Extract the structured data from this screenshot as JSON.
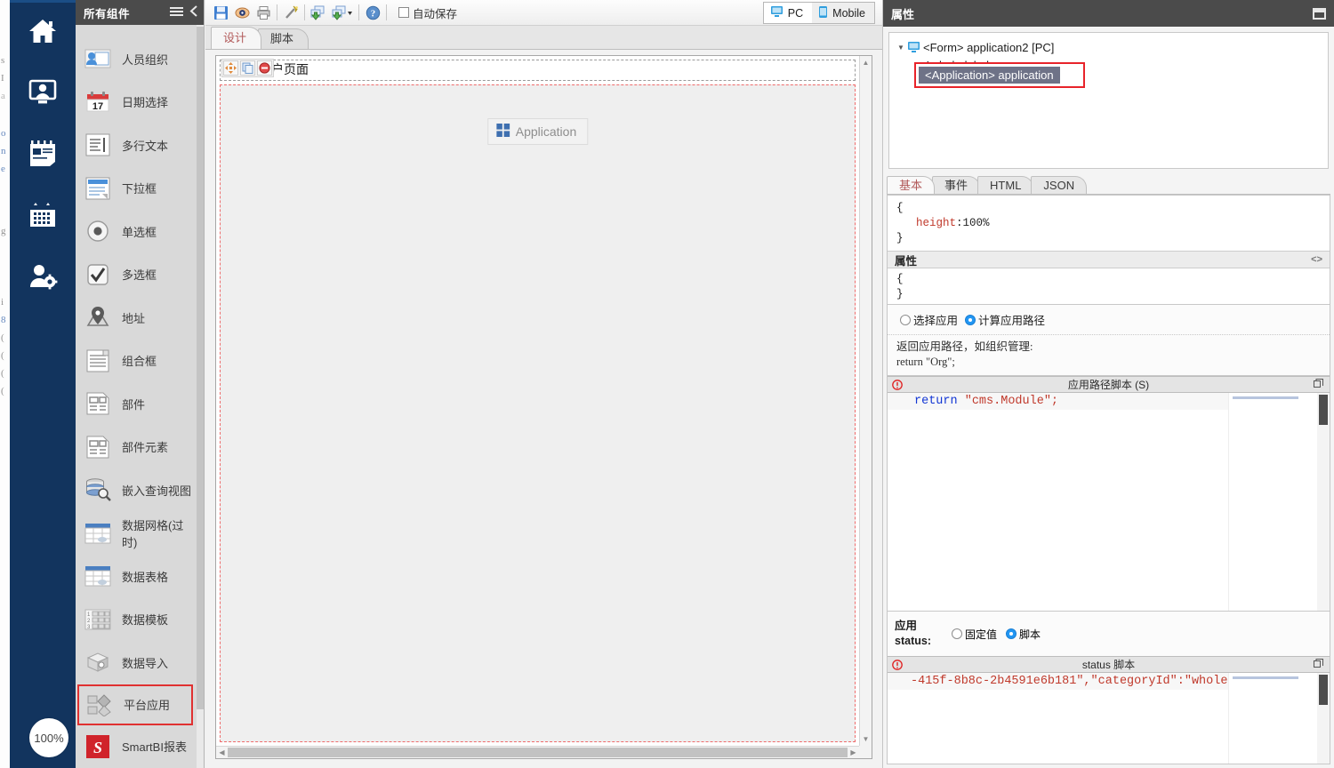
{
  "rail": {
    "items": [
      {
        "name": "home-icon",
        "label": "首页"
      },
      {
        "name": "user-monitor-icon",
        "label": "用户"
      },
      {
        "name": "news-icon",
        "label": "资讯"
      },
      {
        "name": "calendar-icon",
        "label": "日历"
      },
      {
        "name": "user-settings-icon",
        "label": "用户设置"
      }
    ],
    "zoom_badge": "100%"
  },
  "palette": {
    "title": "所有组件",
    "menu_icon": "hamburger-icon",
    "collapse_icon": "chevron-left-icon",
    "items": [
      {
        "label": "人员组织",
        "icon": "person-org-icon"
      },
      {
        "label": "日期选择",
        "icon": "date-picker-icon",
        "day": "17"
      },
      {
        "label": "多行文本",
        "icon": "multiline-text-icon"
      },
      {
        "label": "下拉框",
        "icon": "dropdown-icon"
      },
      {
        "label": "单选框",
        "icon": "radio-icon"
      },
      {
        "label": "多选框",
        "icon": "checkbox-icon"
      },
      {
        "label": "地址",
        "icon": "map-pin-icon"
      },
      {
        "label": "组合框",
        "icon": "combobox-icon"
      },
      {
        "label": "部件",
        "icon": "widget-icon"
      },
      {
        "label": "部件元素",
        "icon": "widget-element-icon"
      },
      {
        "label": "嵌入查询视图",
        "icon": "db-search-icon"
      },
      {
        "label": "数据网格(过时)",
        "icon": "data-grid-icon"
      },
      {
        "label": "数据表格",
        "icon": "data-table-icon"
      },
      {
        "label": "数据模板",
        "icon": "data-template-icon"
      },
      {
        "label": "平台应用",
        "icon": "platform-app-icon",
        "selected": true
      },
      {
        "label": "数据导入",
        "icon": "data-import-icon"
      },
      {
        "label": "SmartBI报表",
        "icon": "smartbi-icon"
      }
    ]
  },
  "toolbar": {
    "buttons": [
      {
        "name": "save-icon",
        "title": "保存"
      },
      {
        "name": "preview-icon",
        "title": "预览"
      },
      {
        "name": "print-icon",
        "title": "打印"
      },
      {
        "name": "wand-icon",
        "title": "向导"
      },
      {
        "name": "publish-icon",
        "title": "发布"
      },
      {
        "name": "publish-as-icon",
        "title": "发布为"
      },
      {
        "name": "help-icon",
        "title": "帮助"
      }
    ],
    "autosave_label": "自动保存",
    "autosave_checked": false,
    "device": {
      "pc_label": "PC",
      "mobile_label": "Mobile",
      "active": "PC"
    }
  },
  "center_tabs": [
    {
      "label": "设计",
      "active": true
    },
    {
      "label": "脚本",
      "active": false
    }
  ],
  "canvas": {
    "form_title": "户页面",
    "mini_tools": [
      "move-icon",
      "copy-icon",
      "delete-icon"
    ],
    "widget_label": "Application",
    "widget_icon": "application-grid-icon"
  },
  "props": {
    "title": "属性",
    "minimize_icon": "minimize-icon",
    "tree": {
      "root": "<Form> application2 [PC]",
      "child": "<Label> label",
      "selected": "<Application> application"
    },
    "tabs": [
      {
        "label": "基本",
        "active": true
      },
      {
        "label": "事件",
        "active": false
      },
      {
        "label": "HTML",
        "active": false
      },
      {
        "label": "JSON",
        "active": false
      }
    ],
    "style_code": {
      "open": "{",
      "key": "height",
      "value": "100%",
      "close": "}"
    },
    "attr_section": {
      "title": "属性",
      "expand_icon": "code-brackets-icon",
      "open": "{",
      "close": "}"
    },
    "app_mode": {
      "option_select": "选择应用",
      "option_compute": "计算应用路径",
      "selected": "计算应用路径"
    },
    "hint": {
      "line1": "返回应用路径，如组织管理:",
      "line2": "return \"Org\";"
    },
    "path_script": {
      "header": "应用路径脚本 (S)",
      "error_icon": "error-icon",
      "restore_icon": "restore-icon",
      "keyword": "return",
      "string": "\"cms.Module\";"
    },
    "status_group": {
      "label_line1": "应用",
      "label_line2": "status:",
      "option_fixed": "固定值",
      "option_script": "脚本",
      "selected": "脚本"
    },
    "status_script": {
      "header": "status 脚本",
      "error_icon": "error-icon",
      "restore_icon": "restore-icon",
      "code": "-415f-8b8c-2b4591e6b181\",\"categoryId\":\"whole\"",
      "code_tail": "}"
    }
  },
  "bg_ghost_lines": [
    "s",
    "I",
    "a",
    "o",
    "n",
    "e",
    "g",
    "i",
    "8",
    "(",
    "(",
    "(",
    "("
  ]
}
